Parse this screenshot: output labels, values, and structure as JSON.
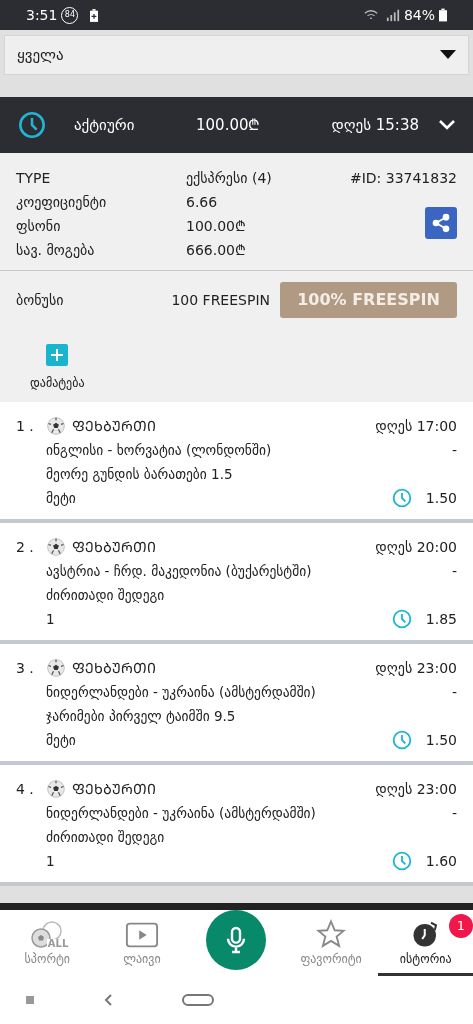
{
  "status_bar": {
    "time": "3:51",
    "badge": "84",
    "battery": "84%"
  },
  "filter": {
    "value": "ყველა"
  },
  "bet_header": {
    "status": "აქტიური",
    "amount": "100.00₾",
    "time": "დღეს 15:38",
    "expanded": true
  },
  "details": [
    {
      "label": "TYPE",
      "value": "ექსპრესი (4)"
    },
    {
      "label": "კოეფიციენტი",
      "value": "6.66"
    },
    {
      "label": "ფსონი",
      "value": "100.00₾"
    },
    {
      "label": "სავ. მოგება",
      "value": "666.00₾"
    }
  ],
  "bet_id": "#ID: 33741832",
  "bonus": {
    "label": "ბონუსი",
    "value": "100 FREESPIN",
    "button": "100% FREESPIN"
  },
  "add_button": "დამატება",
  "selections": [
    {
      "number": "1 .",
      "sport": "ᲤᲔᲮᲑᲣᲠᲗᲘ",
      "time": "დღეს 17:00",
      "match": "ინგლისი - ხორვატია (ლონდონში)",
      "score": "-",
      "market": "მეორე გუნდის ბარათები 1.5",
      "pick": "მეტი",
      "odds": "1.50"
    },
    {
      "number": "2 .",
      "sport": "ᲤᲔᲮᲑᲣᲠᲗᲘ",
      "time": "დღეს 20:00",
      "match": "ავსტრია - ჩრდ. მაკედონია (ბუქარესტში)",
      "score": "-",
      "market": "ძირითადი შედეგი",
      "pick": "1",
      "odds": "1.85"
    },
    {
      "number": "3 .",
      "sport": "ᲤᲔᲮᲑᲣᲠᲗᲘ",
      "time": "დღეს 23:00",
      "match": "ნიდერლანდები - უკრაინა (ამსტერდამში)",
      "score": "-",
      "market": "ჯარიმები პირველ ტაიმში 9.5",
      "pick": "მეტი",
      "odds": "1.50"
    },
    {
      "number": "4 .",
      "sport": "ᲤᲔᲮᲑᲣᲠᲗᲘ",
      "time": "დღეს 23:00",
      "match": "ნიდერლანდები - უკრაინა (ამსტერდამში)",
      "score": "-",
      "market": "ძირითადი შედეგი",
      "pick": "1",
      "odds": "1.60"
    }
  ],
  "bottom_nav": [
    {
      "kind": "sports",
      "label": "სპორტი",
      "icon_text": "ALL",
      "selected": false
    },
    {
      "kind": "live",
      "label": "ლაივი",
      "selected": false
    },
    {
      "kind": "mic"
    },
    {
      "kind": "favorites",
      "label": "ფავორიტი",
      "selected": false
    },
    {
      "kind": "history",
      "label": "ისტორია",
      "selected": true,
      "badge": "1"
    }
  ]
}
